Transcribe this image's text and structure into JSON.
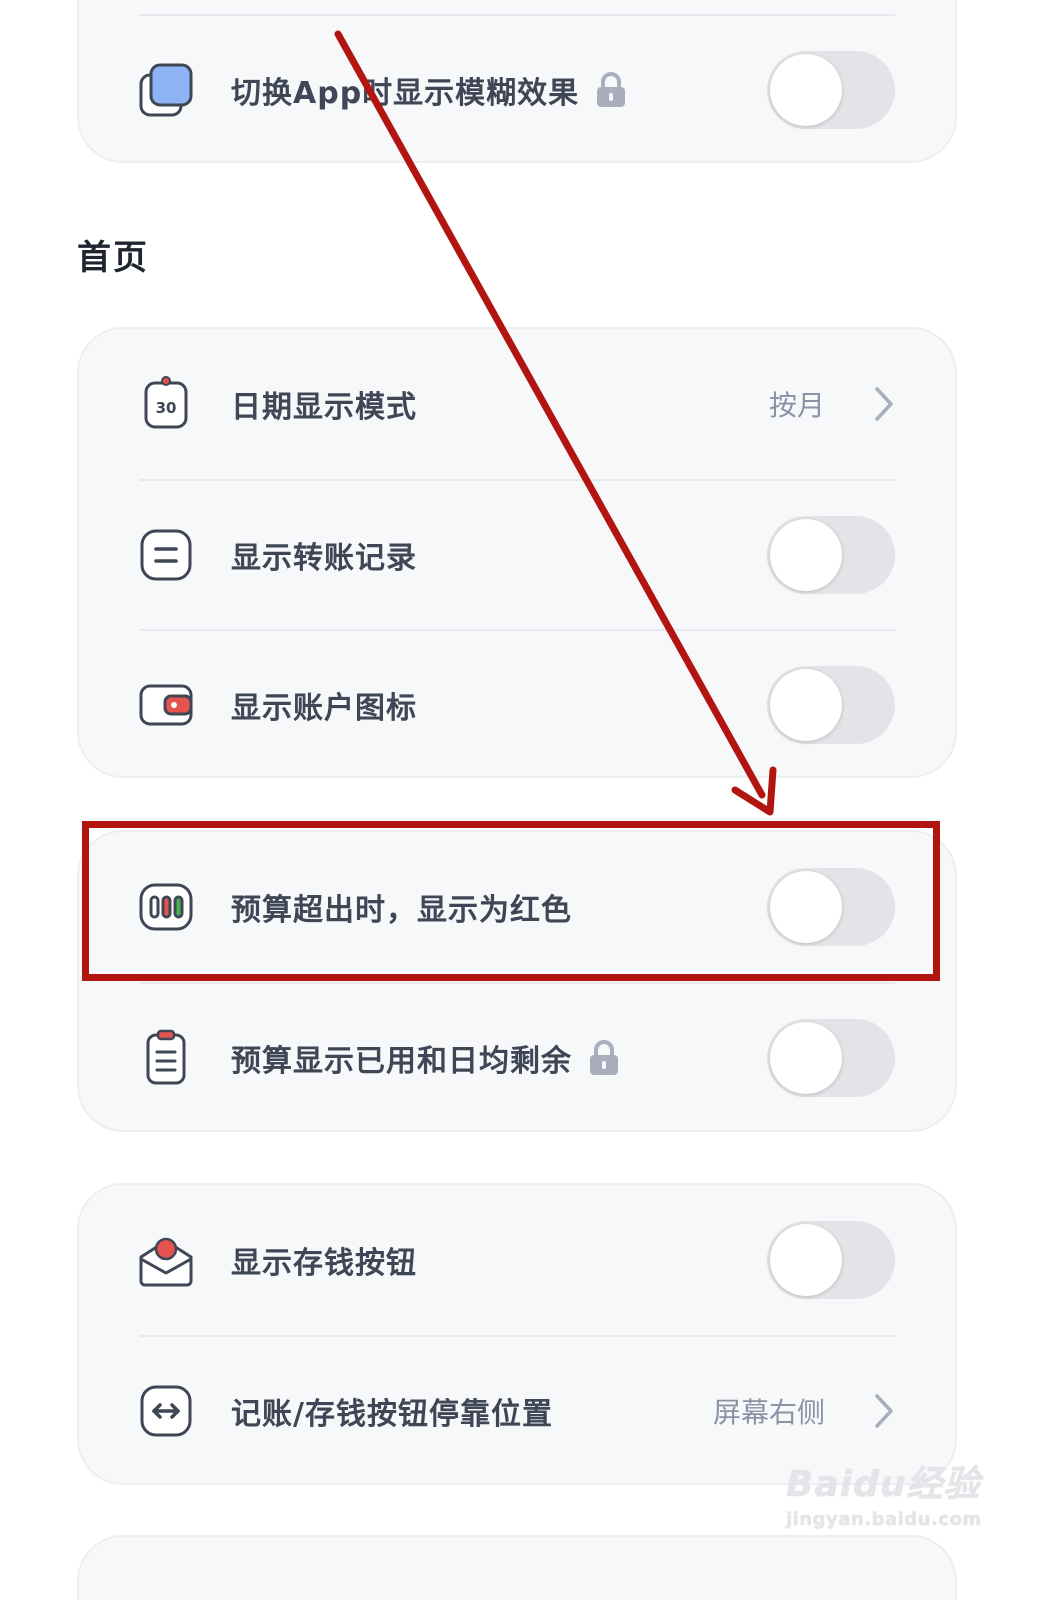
{
  "top_card": {
    "blur_row": {
      "label": "切换App时显示模糊效果",
      "toggle_on": false,
      "locked": true
    }
  },
  "section": {
    "title": "首页"
  },
  "homepage_card": {
    "date_mode": {
      "label": "日期显示模式",
      "value": "按月",
      "icon_text": "30"
    },
    "transfer": {
      "label": "显示转账记录",
      "toggle_on": false
    },
    "account_icon": {
      "label": "显示账户图标",
      "toggle_on": false
    }
  },
  "budget_card": {
    "budget_red": {
      "label": "预算超出时，显示为红色",
      "toggle_on": false
    },
    "budget_daily": {
      "label": "预算显示已用和日均剩余",
      "toggle_on": false,
      "locked": true
    }
  },
  "savings_card": {
    "savings_button": {
      "label": "显示存钱按钮",
      "toggle_on": false
    },
    "dock_position": {
      "label": "记账/存钱按钮停靠位置",
      "value": "屏幕右侧"
    }
  },
  "watermark": {
    "brand": "Baidu经验",
    "site": "jingyan.baidu.com"
  },
  "colors": {
    "annotation_red": "#b2140f",
    "card_bg": "#f7f8fa",
    "label_text": "#3f4656",
    "value_text": "#8a93a6",
    "toggle_off": "#e3e4e7",
    "icon_blue": "#8fb4f5",
    "icon_red": "#e6534e",
    "icon_green": "#4caf50"
  }
}
